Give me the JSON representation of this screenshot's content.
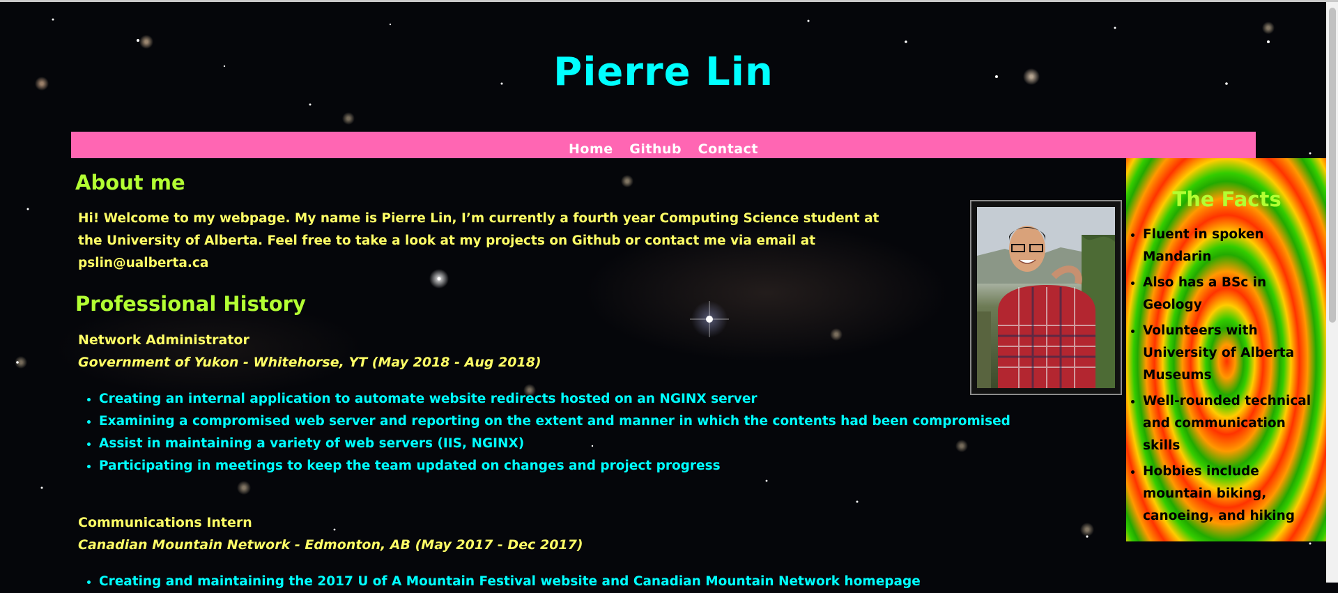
{
  "site": {
    "title": "Pierre Lin"
  },
  "nav": {
    "items": [
      "Home",
      "Github",
      "Contact"
    ]
  },
  "about": {
    "heading": "About me",
    "text": "Hi! Welcome to my webpage. My name is Pierre Lin, I’m currently a fourth year Computing Science student at the University of Alberta. Feel free to take a look at my projects on Github or contact me via email at pslin@ualberta.ca"
  },
  "history": {
    "heading": "Professional History",
    "jobs": [
      {
        "title": "Network Administrator",
        "org": "Government of Yukon - Whitehorse, YT (May 2018 - Aug 2018)",
        "duties": [
          "Creating an internal application to automate website redirects hosted on an NGINX server",
          "Examining a compromised web server and reporting on the extent and manner in which the contents had been compromised",
          "Assist in maintaining a variety of web servers (IIS, NGINX)",
          "Participating in meetings to keep the team updated on changes and project progress"
        ]
      },
      {
        "title": "Communications Intern",
        "org": "Canadian Mountain Network - Edmonton, AB (May 2017 - Dec 2017)",
        "duties": [
          "Creating and maintaining the 2017 U of A Mountain Festival website and Canadian Mountain Network homepage"
        ]
      }
    ]
  },
  "facts": {
    "heading": "The Facts",
    "items": [
      "Fluent in spoken Mandarin",
      "Also has a BSc in Geology",
      "Volunteers with University of Alberta Museums",
      "Well-rounded technical and communication skills",
      "Hobbies include mountain biking, canoeing, and hiking"
    ]
  },
  "colors": {
    "title": "#00ffff",
    "nav_bg": "#ff66b3",
    "heading": "#b3ff33",
    "body_text": "#ffff66",
    "list_text": "#00ffff"
  }
}
